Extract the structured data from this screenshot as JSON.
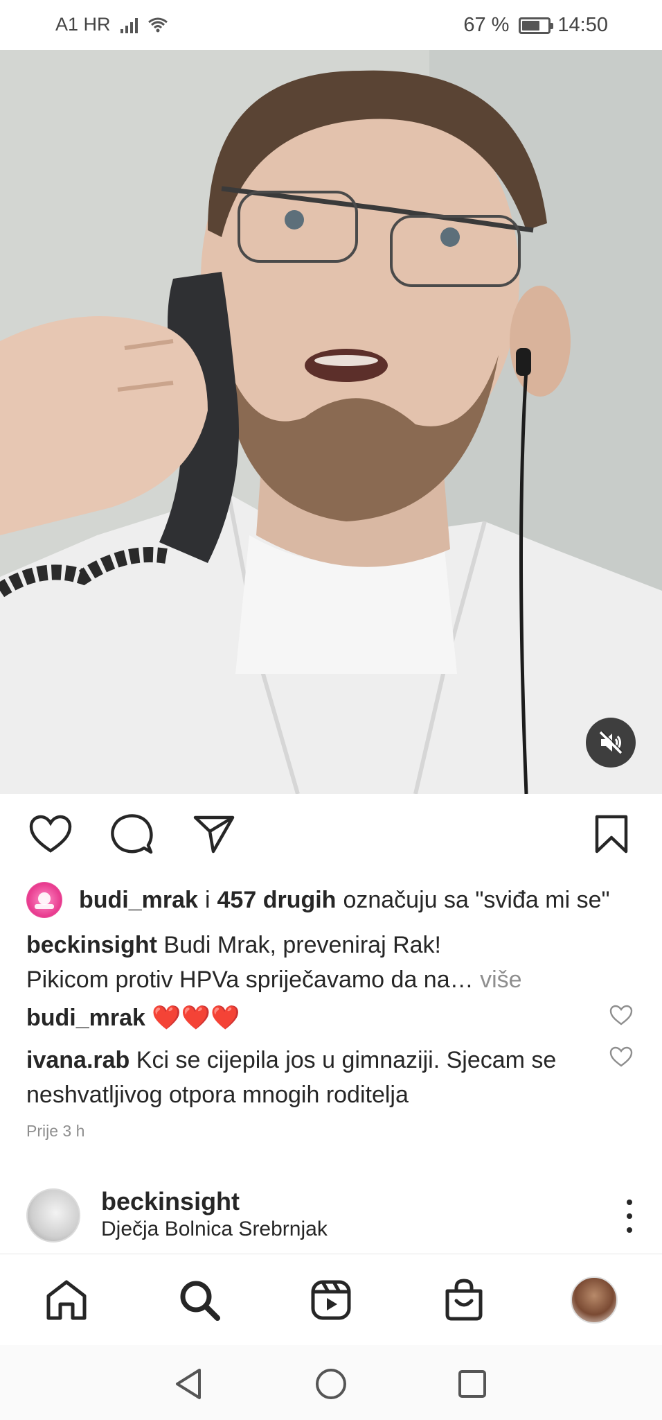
{
  "status_bar": {
    "carrier": "A1 HR",
    "battery": "67 %",
    "time": "14:50"
  },
  "post": {
    "liked_by_user": "budi_mrak",
    "liked_connector": "i",
    "liked_others": "457 drugih",
    "liked_suffix": "označuju sa \"sviđa mi se\"",
    "caption_user": "beckinsight",
    "caption_line1": "Budi Mrak, preveniraj Rak!",
    "caption_line2": "Pikicom protiv HPVa spriječavamo da na…",
    "caption_more": "više",
    "comments": [
      {
        "user": "budi_mrak",
        "text": "❤️❤️❤️"
      },
      {
        "user": "ivana.rab",
        "text": "Kci se cijepila jos u gimnaziji. Sjecam se neshvatljivog otpora mnogih roditelja"
      }
    ],
    "time_ago": "Prije 3 h"
  },
  "next_post": {
    "username": "beckinsight",
    "location": "Dječja Bolnica Srebrnjak"
  },
  "icons": {
    "like": "heart-icon",
    "comment": "comment-icon",
    "share": "send-icon",
    "save": "bookmark-icon",
    "mute": "muted-speaker-icon"
  }
}
